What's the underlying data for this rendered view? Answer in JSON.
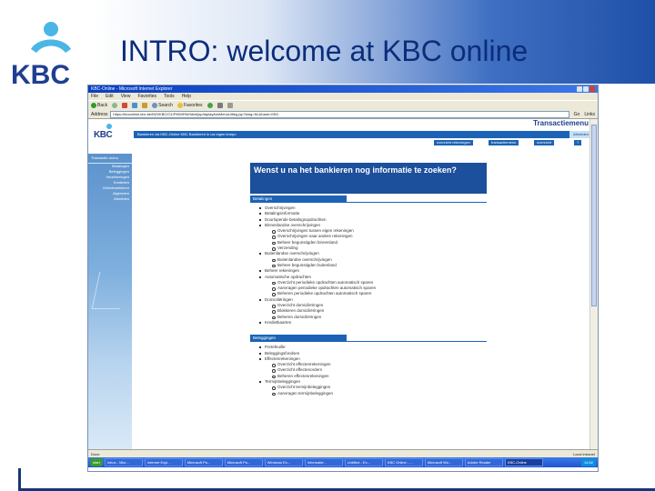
{
  "slide": {
    "title": "INTRO: welcome at KBC online",
    "logo_text": "KBC",
    "colors": {
      "title": "#0b2d7a",
      "brand_blue": "#1f3f8f",
      "accent_cyan": "#4ab6e6"
    }
  },
  "browser": {
    "title": "KBC-Online - Microsoft Internet Explorer",
    "menu": [
      "File",
      "Edit",
      "View",
      "Favorites",
      "Tools",
      "Help"
    ],
    "toolbar": {
      "back": "Back",
      "search": "Search",
      "favorites": "Favorites"
    },
    "address_label": "Address",
    "address_value": "https://kbconline.kbc.be/INS/KBC/O1/PKB/IRW/html/jsp/taplay/tanMenuUitleg.jsp?lang=NL&bank=KBC",
    "go_label": "Go",
    "links_label": "Links",
    "status_left": "Done",
    "status_right": "Local intranet"
  },
  "kbc_page": {
    "logo_text": "KBC",
    "menu_title": "Transactiemenu",
    "navbar_text": "Bankieren via KBC-Online   KBC Bankieren in uw eigen tempo",
    "afmelden": "Afmelden",
    "pills": [
      "overzicht rekeningen",
      "transactiemenu",
      "overzicht",
      "?"
    ],
    "side": {
      "heading": "Transactie-menu",
      "items": [
        "Betalingen",
        "Beleggingen",
        "Verzekeringen",
        "Kredieten",
        "Onlinebankieren",
        "Algemeen",
        "Afmelden"
      ]
    },
    "headline": "Wenst u na het bankieren nog informatie te zoeken?",
    "sections": [
      {
        "title": "Betalingen",
        "items": [
          {
            "label": "Overschrijvingen"
          },
          {
            "label": "Betalingsinformatie"
          },
          {
            "label": "Doorlopende betalingsopdrachten"
          },
          {
            "label": "Binnenlandse overschrijvingen",
            "sub": [
              "Overschrijvingen tussen eigen rekeningen",
              "Overschrijvingen naar andere rekeningen",
              "Beheer begunstigden binnenland",
              "Verzending"
            ]
          },
          {
            "label": "Buitenlandse overschrijvingen",
            "sub": [
              "Buitenlandse overschrijvingen",
              "Beheer begunstigden buitenland"
            ]
          },
          {
            "label": "Beheer rekeningen"
          },
          {
            "label": "Automatische opdrachten",
            "sub": [
              "Overzicht periodieke opdrachten automatisch sparen",
              "Aanvragen periodieke opdrachten automatisch sparen",
              "Beheren periodieke opdrachten automatisch sparen"
            ]
          },
          {
            "label": "Domiciliëringen",
            "sub": [
              "Overzicht domiciliëringen",
              "Blokkeren domiciliëringen",
              "Beheren domiciliëringen"
            ]
          },
          {
            "label": "Kredietkaarten"
          }
        ]
      },
      {
        "title": "Beleggingen",
        "items": [
          {
            "label": "Portefeuille"
          },
          {
            "label": "Beleggingsfondsen"
          },
          {
            "label": "Effectenrekeningen",
            "sub": [
              "Overzicht effectenrekeningen",
              "Overzicht effectenorders",
              "Beheren effectenrekeningen"
            ]
          },
          {
            "label": "Termijnbeleggingen",
            "sub": [
              "Overzicht termijnbeleggingen",
              "Aanvragen termijnbeleggingen"
            ]
          }
        ]
      }
    ]
  },
  "taskbar": {
    "start": "start",
    "tasks": [
      "Inbox - Micr...",
      "Internet Expl...",
      "Microsoft Po...",
      "Microsoft Po...",
      "Windows Ex...",
      "Informatie...",
      "Untitled - Ex...",
      "KBC Online - ...",
      "Microsoft Wo...",
      "Adobe Reader",
      "KBC-Online"
    ],
    "clock": "14:52"
  }
}
